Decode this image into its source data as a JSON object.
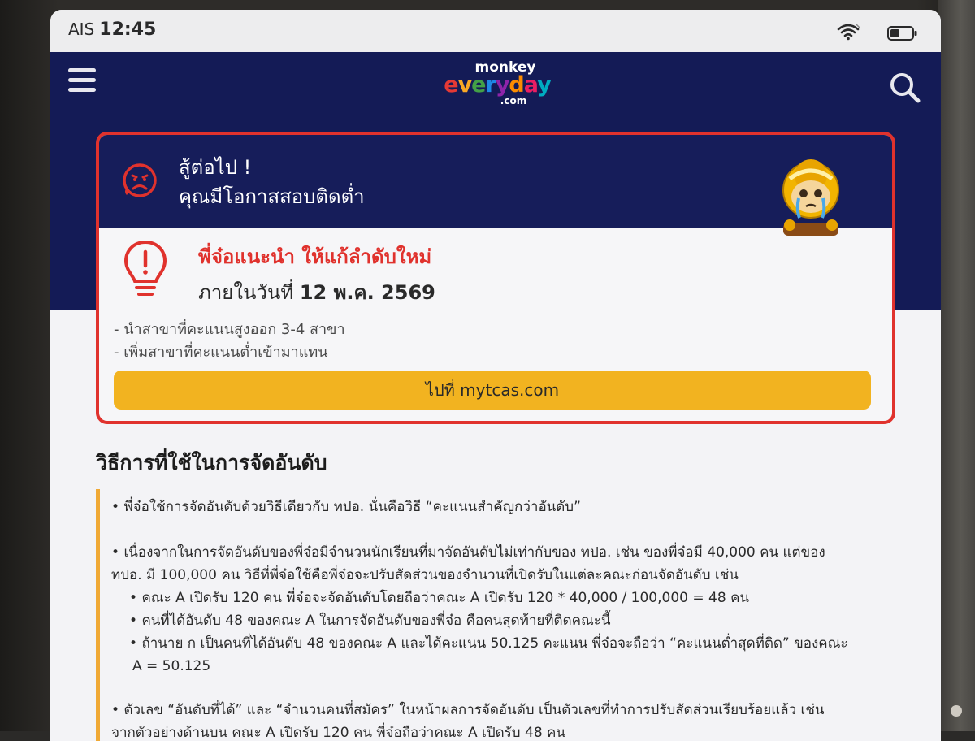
{
  "status_bar": {
    "carrier": "AIS",
    "time": "12:45"
  },
  "header": {
    "logo_top": "monkey",
    "logo_main": "everyday",
    "logo_sub": ".com",
    "logo_colors": [
      "#e53935",
      "#f9a825",
      "#43a047",
      "#1e88e5",
      "#8e24aa",
      "#fb8c00",
      "#e91e63",
      "#00acc1"
    ]
  },
  "result_card": {
    "title_line1": "สู้ต่อไป !",
    "title_line2": "คุณมีโอกาสสอบติดต่ำ",
    "advice_title": "พี่จ๋อแนะนำ ให้แก้ลำดับใหม่",
    "deadline_prefix": "ภายในวันที่",
    "deadline_date": "12 พ.ค. 2569",
    "tips": [
      "- นำสาขาที่คะแนนสูงออก 3-4 สาขา",
      "- เพิ่มสาขาที่คะแนนต่ำเข้ามาแทน"
    ],
    "button_label": "ไปที่ mytcas.com"
  },
  "method_section": {
    "title": "วิธีการที่ใช้ในการจัดอันดับ",
    "paragraph1": "พี่จ๋อใช้การจัดอันดับด้วยวิธีเดียวกับ ทปอ. นั่นคือวิธี “คะแนนสำคัญกว่าอันดับ”",
    "paragraph2_line1": "เนื่องจากในการจัดอันดับของพี่จ๋อมีจำนวนนักเรียนที่มาจัดอันดับไม่เท่ากับของ ทปอ. เช่น ของพี่จ๋อมี 40,000 คน แต่ของ",
    "paragraph2_line2": "ทปอ. มี 100,000 คน วิธีที่พี่จ๋อใช้คือพี่จ๋อจะปรับสัดส่วนของจำนวนที่เปิดรับในแต่ละคณะก่อนจัดอันดับ เช่น",
    "sub_items": [
      "คณะ A เปิดรับ 120 คน พี่จ๋อจะจัดอันดับโดยถือว่าคณะ A เปิดรับ 120 * 40,000 / 100,000 = 48 คน",
      "คนที่ได้อันดับ 48 ของคณะ A ในการจัดอันดับของพี่จ๋อ คือคนสุดท้ายที่ติดคณะนี้",
      "ถ้านาย ก เป็นคนที่ได้อันดับ 48 ของคณะ A และได้คะแนน 50.125 คะแนน พี่จ๋อจะถือว่า “คะแนนต่ำสุดที่ติด” ของคณะ"
    ],
    "sub_item3_cont": "A = 50.125",
    "paragraph3_line1": "ตัวเลข “อันดับที่ได้” และ “จำนวนคนที่สมัคร” ในหน้าผลการจัดอันดับ เป็นตัวเลขที่ทำการปรับสัดส่วนเรียบร้อยแล้ว เช่น",
    "paragraph3_line2": "จากตัวอย่างด้านบน คณะ A เปิดรับ 120 คน พี่จ๋อถือว่าคณะ A เปิดรับ 48 คน"
  },
  "colors": {
    "navy": "#141b56",
    "alert_red": "#e0322d",
    "button_yellow": "#f2b320",
    "accent_orange": "#f0a935"
  }
}
